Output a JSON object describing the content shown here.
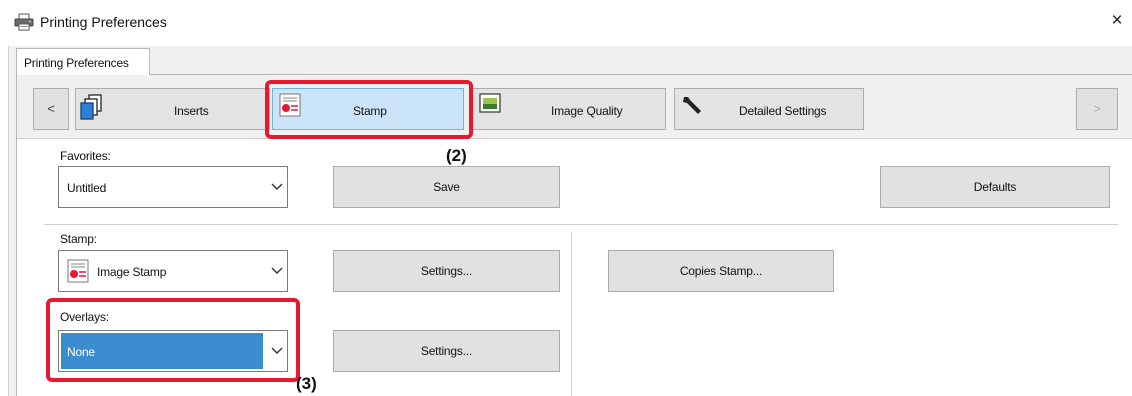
{
  "window": {
    "title": "Printing Preferences",
    "close_glyph": "×"
  },
  "outer_tab": {
    "label": "Printing Preferences"
  },
  "tabs": {
    "prev_glyph": "<",
    "next_glyph": ">",
    "items": [
      {
        "label": "Inserts",
        "icon": "copies-icon"
      },
      {
        "label": "Stamp",
        "icon": "stamp-icon",
        "selected": true
      },
      {
        "label": "Image Quality",
        "icon": "image-quality-icon"
      },
      {
        "label": "Detailed Settings",
        "icon": "wrench-icon"
      }
    ]
  },
  "favorites": {
    "label": "Favorites:",
    "value": "Untitled",
    "save_label": "Save",
    "defaults_label": "Defaults"
  },
  "stamp": {
    "label": "Stamp:",
    "value": "Image Stamp",
    "settings_label": "Settings...",
    "copies_stamp_label": "Copies Stamp..."
  },
  "overlays": {
    "label": "Overlays:",
    "value": "None",
    "settings_label": "Settings..."
  },
  "callouts": {
    "two": "(2)",
    "three": "(3)"
  },
  "colors": {
    "highlight": "#e5192f",
    "selected_tab": "#cce4f7",
    "selected_combo": "#3c8cd0"
  }
}
